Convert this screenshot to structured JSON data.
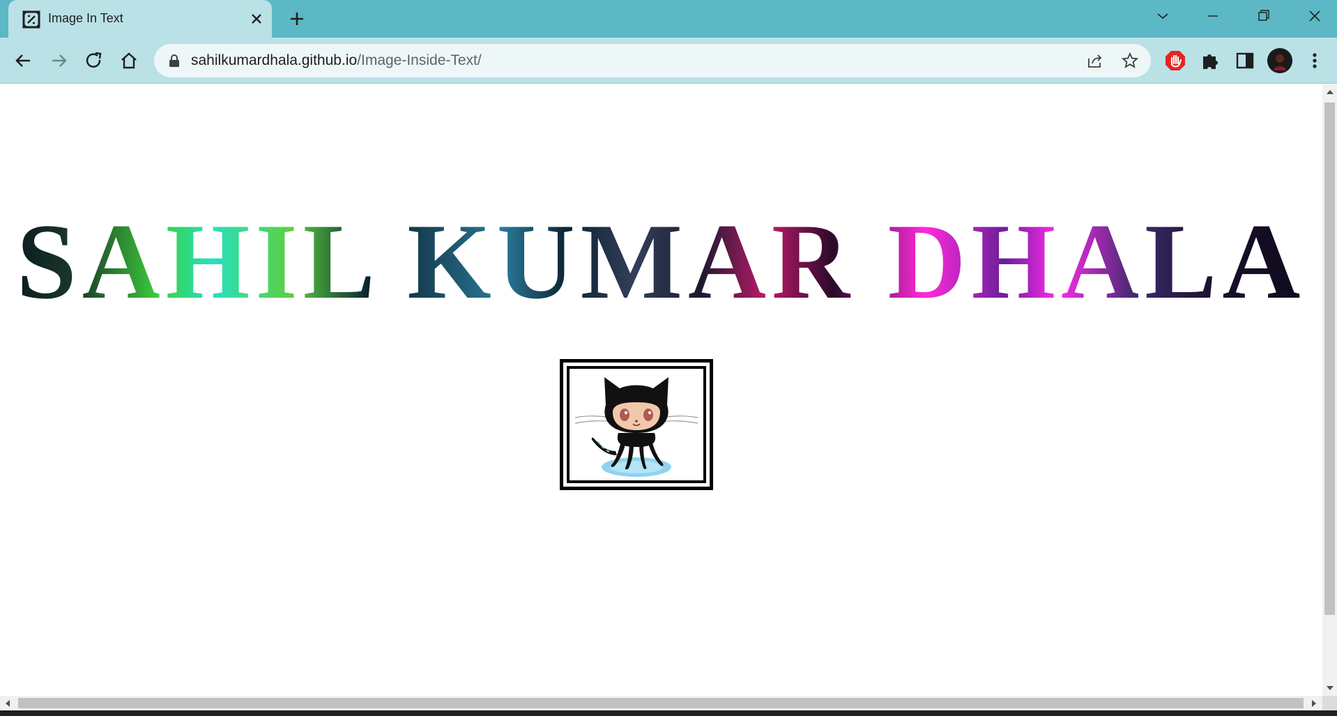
{
  "browser": {
    "tab": {
      "title": "Image In Text",
      "favicon": "picture-frame-icon"
    },
    "new_tab_icon": "plus-icon",
    "window_controls": [
      "chevron-down-icon",
      "minimize-icon",
      "restore-icon",
      "close-icon"
    ],
    "nav": {
      "back_icon": "arrow-left-icon",
      "forward_icon": "arrow-right-icon",
      "reload_icon": "reload-icon",
      "home_icon": "home-icon"
    },
    "address_bar": {
      "domain": "sahilkumardhala.github.io",
      "path": "/Image-Inside-Text/",
      "lock_icon": "lock-icon",
      "share_icon": "share-icon",
      "bookmark_icon": "star-icon"
    },
    "extensions": [
      "adblock-hand-icon",
      "puzzle-icon",
      "side-panel-icon"
    ],
    "menu_icon": "kebab-menu-icon"
  },
  "page": {
    "headline": "SAHIL KUMAR DHALA",
    "image_alt": "GitHub Octocat",
    "colors": {
      "text_gradient": [
        "#08141f",
        "#3ccf3a",
        "#27e0c0",
        "#2a7a9a",
        "#1a1a2e",
        "#c01a6a",
        "#ff2adc",
        "#6a1f9a",
        "#0c0a1a"
      ],
      "frame_border": "#000000"
    }
  },
  "theme": {
    "tabstrip": "#5bb8c4",
    "toolbar": "#b9e1e6",
    "omnibox": "#eef7f8"
  }
}
